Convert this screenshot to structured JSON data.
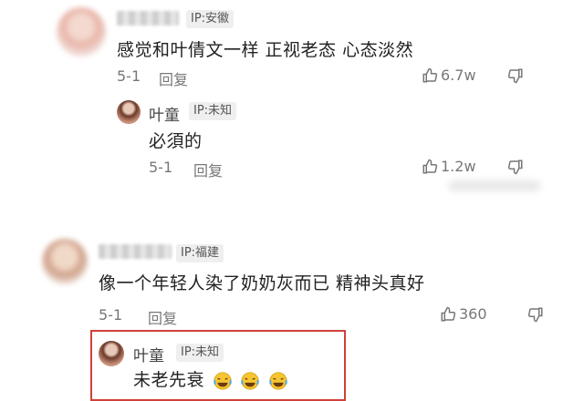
{
  "comments": [
    {
      "ip": "IP:安徽",
      "text": "感觉和叶倩文一样 正视老态 心态淡然",
      "date": "5-1",
      "reply_label": "回复",
      "likes": "6.7w",
      "replies": [
        {
          "name": "叶童",
          "ip": "IP:未知",
          "text": "必須的",
          "date": "5-1",
          "reply_label": "回复",
          "likes": "1.2w"
        }
      ]
    },
    {
      "ip": "IP:福建",
      "text": "像一个年轻人染了奶奶灰而已 精神头真好",
      "date": "5-1",
      "reply_label": "回复",
      "likes": "360",
      "replies": [
        {
          "name": "叶童",
          "ip": "IP:未知",
          "text": "未老先衰",
          "emoji": [
            "crying-laughing-emoji",
            "crying-laughing-emoji",
            "crying-laughing-emoji"
          ]
        }
      ]
    }
  ],
  "colors": {
    "highlight": "#d0403a",
    "ip_tag_bg": "#efefef"
  },
  "icons": [
    "thumbs-up-icon",
    "thumbs-down-icon"
  ]
}
